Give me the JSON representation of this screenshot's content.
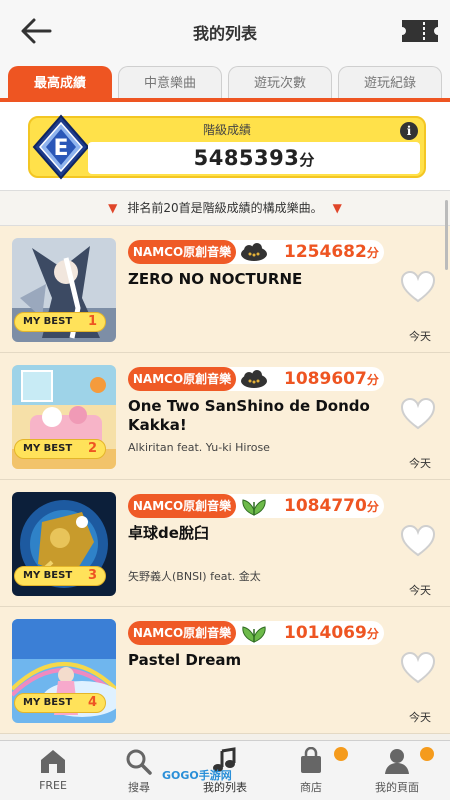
{
  "header": {
    "title": "我的列表"
  },
  "tabs": [
    {
      "label": "最高成績",
      "active": true
    },
    {
      "label": "中意樂曲",
      "active": false
    },
    {
      "label": "遊玩次數",
      "active": false
    },
    {
      "label": "遊玩紀錄",
      "active": false
    }
  ],
  "grade": {
    "label": "階級成績",
    "letter": "E",
    "score": "5485393",
    "unit": "分",
    "info": "i"
  },
  "notice": {
    "text": "排名前20首是階級成績的構成樂曲。"
  },
  "songs": [
    {
      "genre": "NAMCO原創音樂",
      "difficulty_icon": "cloud-difficulty-icon",
      "score": "1254682",
      "unit": "分",
      "title": "ZERO NO NOCTURNE",
      "artist": "",
      "badge": "MY BEST",
      "rank": "1",
      "date": "今天"
    },
    {
      "genre": "NAMCO原創音樂",
      "difficulty_icon": "cloud-difficulty-icon",
      "score": "1089607",
      "unit": "分",
      "title": "One Two SanShino de Dondo Kakka!",
      "artist": "Alkiritan feat. Yu-ki Hirose",
      "badge": "MY BEST",
      "rank": "2",
      "date": "今天"
    },
    {
      "genre": "NAMCO原創音樂",
      "difficulty_icon": "leaf-difficulty-icon",
      "score": "1084770",
      "unit": "分",
      "title": "卓球de脫臼",
      "artist": "矢野義人(BNSI) feat. 金太",
      "badge": "MY BEST",
      "rank": "3",
      "date": "今天"
    },
    {
      "genre": "NAMCO原創音樂",
      "difficulty_icon": "leaf-difficulty-icon",
      "score": "1014069",
      "unit": "分",
      "title": "Pastel Dream",
      "artist": "",
      "badge": "MY BEST",
      "rank": "4",
      "date": "今天"
    }
  ],
  "nav": [
    {
      "label": "FREE",
      "icon": "home-icon"
    },
    {
      "label": "搜尋",
      "icon": "search-icon"
    },
    {
      "label": "我的列表",
      "icon": "music-note-icon"
    },
    {
      "label": "商店",
      "icon": "shopping-bag-icon"
    },
    {
      "label": "我的頁面",
      "icon": "user-icon"
    }
  ],
  "watermark": "GOGO手游网",
  "colors": {
    "accent": "#ee5522",
    "grade_card": "#ffe14a",
    "row_bg": "#fbefd9",
    "badge_dot": "#f59b1c"
  }
}
